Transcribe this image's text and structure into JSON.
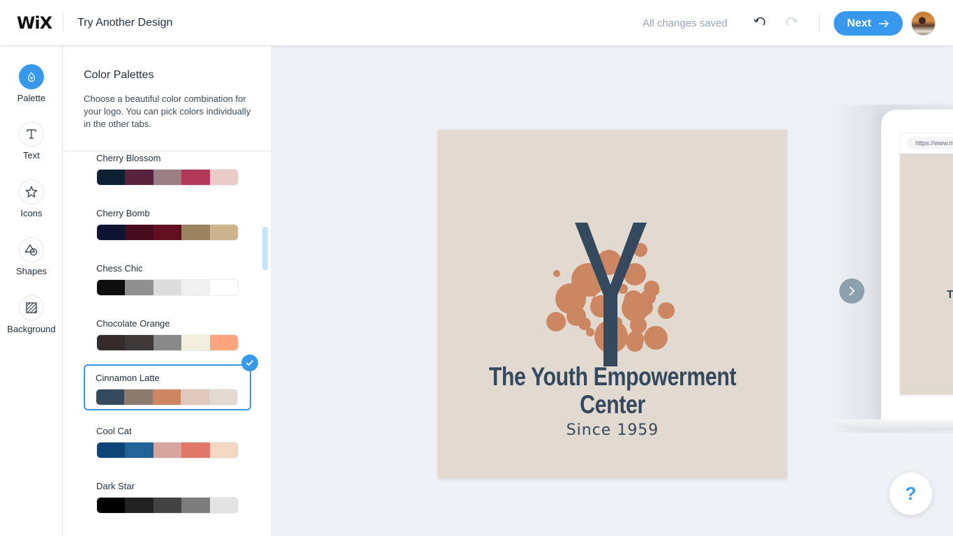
{
  "header": {
    "brand": "WiX",
    "title": "Try Another Design",
    "status": "All changes saved",
    "next_label": "Next",
    "icons": {
      "undo": "undo-icon",
      "redo": "redo-icon",
      "next_arrow": "arrow-right-icon",
      "avatar": "user-avatar"
    }
  },
  "leftnav": {
    "items": [
      {
        "label": "Palette",
        "icon": "water-drop-icon",
        "active": true
      },
      {
        "label": "Text",
        "icon": "text-t-icon",
        "active": false
      },
      {
        "label": "Icons",
        "icon": "star-icon",
        "active": false
      },
      {
        "label": "Shapes",
        "icon": "shapes-icon",
        "active": false
      },
      {
        "label": "Background",
        "icon": "hatched-square-icon",
        "active": false
      }
    ]
  },
  "panel": {
    "title": "Color Palettes",
    "description": "Choose a beautiful color combination for your logo. You can pick colors individually in the other tabs.",
    "palettes": [
      {
        "name": "Cherry Blossom",
        "colors": [
          "#0d1f33",
          "#5a233d",
          "#9b7e84",
          "#b2385a",
          "#ebcaca"
        ],
        "selected": false
      },
      {
        "name": "Cherry Bomb",
        "colors": [
          "#0f1432",
          "#470b1f",
          "#610d20",
          "#9b8260",
          "#cdb38e"
        ],
        "selected": false
      },
      {
        "name": "Chess Chic",
        "colors": [
          "#0e0e0e",
          "#909090",
          "#dcdcdc",
          "#f0f0f0",
          "#ffffff"
        ],
        "selected": false
      },
      {
        "name": "Chocolate Orange",
        "colors": [
          "#342a2a",
          "#3e3838",
          "#8b8a8a",
          "#f2efdf",
          "#fda57f"
        ],
        "selected": false
      },
      {
        "name": "Cinnamon Latte",
        "colors": [
          "#34495e",
          "#8c7a6e",
          "#cc8661",
          "#dfc7bc",
          "#e2dad0"
        ],
        "selected": true
      },
      {
        "name": "Cool Cat",
        "colors": [
          "#0c4576",
          "#226297",
          "#d7a59f",
          "#e07769",
          "#f1d7c2"
        ],
        "selected": false
      },
      {
        "name": "Dark Star",
        "colors": [
          "#000000",
          "#222222",
          "#434343",
          "#7c7c7c",
          "#e3e3e3"
        ],
        "selected": false
      }
    ]
  },
  "logo": {
    "letter": "Y",
    "title": "The Youth Empowerment Center",
    "subtitle": "Since 1959",
    "colors": {
      "background": "#e2dad0",
      "primary": "#34495e",
      "accent": "#cc8661"
    }
  },
  "preview": {
    "url": "https://www.m",
    "letter": "T",
    "next_icon": "chevron-right-icon"
  },
  "help": {
    "label": "?"
  }
}
